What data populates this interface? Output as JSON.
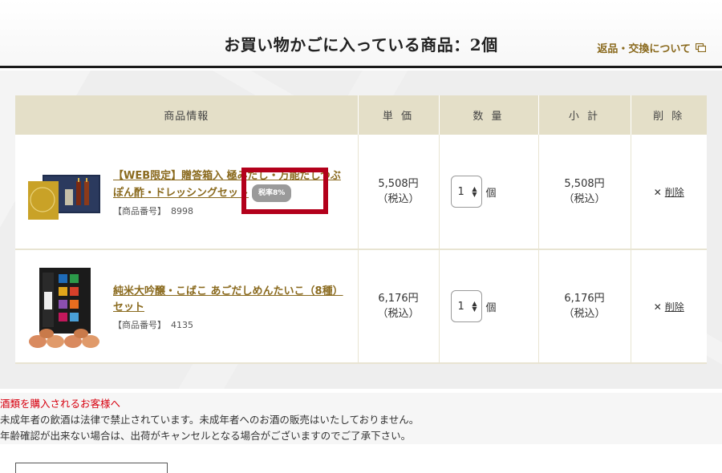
{
  "header": {
    "title": "お買い物かごに入っている商品：2個",
    "return_link": "返品・交換について"
  },
  "table": {
    "columns": [
      "商品情報",
      "単 価",
      "数 量",
      "小 計",
      "削 除"
    ]
  },
  "items": [
    {
      "name": "【WEB限定】贈答箱入 極みだし・万能だしつぶぽん酢・ドレッシングセット",
      "tax_badge": "税率8%",
      "no_label": "【商品番号】",
      "no": "8998",
      "price": "5,508円",
      "price_tax": "（税込）",
      "qty": "1",
      "qty_unit": "個",
      "subtotal": "5,508円",
      "subtotal_tax": "（税込）",
      "delete": "削除"
    },
    {
      "name": "純米大吟醸・こばこ あごだしめんたいこ（8種）セット",
      "no_label": "【商品番号】",
      "no": "4135",
      "price": "6,176円",
      "price_tax": "（税込）",
      "qty": "1",
      "qty_unit": "個",
      "subtotal": "6,176円",
      "subtotal_tax": "（税込）",
      "delete": "削除"
    }
  ],
  "notice": {
    "title": "酒類を購入されるお客様へ",
    "line1": "未成年者の飲酒は法律で禁止されています。未成年者へのお酒の販売はいたしておりません。",
    "line2": "年齢確認が出来ない場合は、出荷がキャンセルとなる場合がございますのでご了承下さい。"
  },
  "colors": {
    "accent": "#8a6a1e",
    "header_bg": "#e4dfc8",
    "highlight": "#b3001b",
    "notice_red": "#d7000f"
  }
}
